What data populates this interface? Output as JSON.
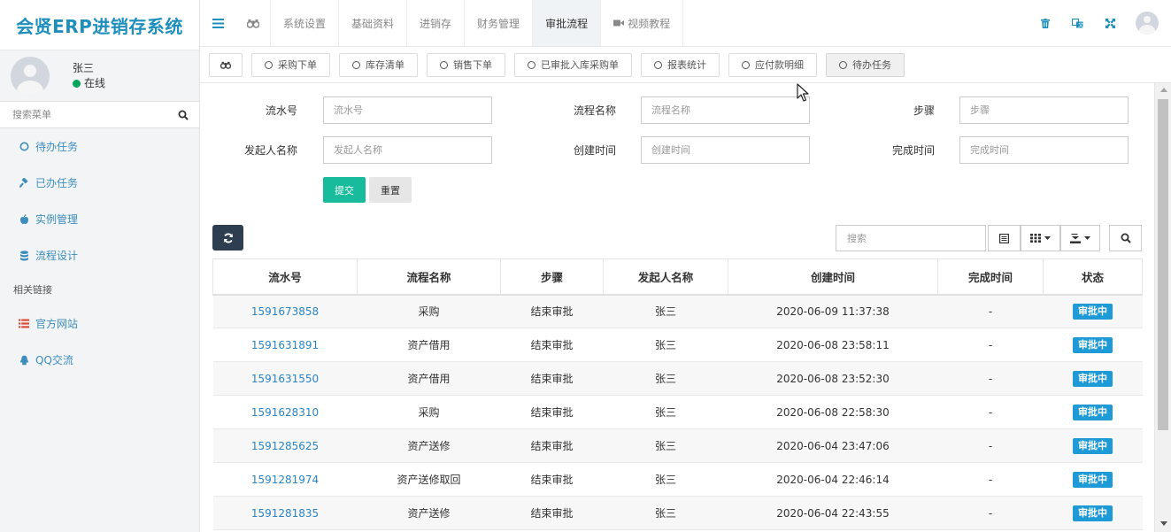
{
  "app": {
    "title": "会贤ERP进销存系统"
  },
  "user": {
    "name": "张三",
    "status": "在线"
  },
  "sidebar": {
    "search_placeholder": "搜索菜单",
    "items": [
      {
        "label": "待办任务",
        "icon": "circle-icon"
      },
      {
        "label": "已办任务",
        "icon": "gavel-icon"
      },
      {
        "label": "实例管理",
        "icon": "apple-icon"
      },
      {
        "label": "流程设计",
        "icon": "database-icon"
      }
    ],
    "section_header": "相关链接",
    "links": [
      {
        "label": "官方网站",
        "icon": "list-icon",
        "color": "#dd4b39"
      },
      {
        "label": "QQ交流",
        "icon": "qq-icon",
        "color": "#3c8dbc"
      }
    ]
  },
  "topnav": {
    "items": [
      "系统设置",
      "基础资料",
      "进销存",
      "财务管理",
      "审批流程",
      "视频教程"
    ],
    "active": "审批流程"
  },
  "tabs": {
    "items": [
      "采购下单",
      "库存清单",
      "销售下单",
      "已审批入库采购单",
      "报表统计",
      "应付款明细",
      "待办任务"
    ],
    "active": "待办任务"
  },
  "form": {
    "fields": [
      {
        "label": "流水号",
        "placeholder": "流水号"
      },
      {
        "label": "流程名称",
        "placeholder": "流程名称"
      },
      {
        "label": "步骤",
        "placeholder": "步骤"
      },
      {
        "label": "发起人名称",
        "placeholder": "发起人名称"
      },
      {
        "label": "创建时间",
        "placeholder": "创建时间"
      },
      {
        "label": "完成时间",
        "placeholder": "完成时间"
      }
    ],
    "submit_label": "提交",
    "reset_label": "重置"
  },
  "table": {
    "search_placeholder": "搜索",
    "columns": [
      "流水号",
      "流程名称",
      "步骤",
      "发起人名称",
      "创建时间",
      "完成时间",
      "状态"
    ],
    "rows": [
      [
        "1591673858",
        "采购",
        "结束审批",
        "张三",
        "2020-06-09 11:37:38",
        "-",
        "审批中"
      ],
      [
        "1591631891",
        "资产借用",
        "结束审批",
        "张三",
        "2020-06-08 23:58:11",
        "-",
        "审批中"
      ],
      [
        "1591631550",
        "资产借用",
        "结束审批",
        "张三",
        "2020-06-08 23:52:30",
        "-",
        "审批中"
      ],
      [
        "1591628310",
        "采购",
        "结束审批",
        "张三",
        "2020-06-08 22:58:30",
        "-",
        "审批中"
      ],
      [
        "1591285625",
        "资产送修",
        "结束审批",
        "张三",
        "2020-06-04 23:47:06",
        "-",
        "审批中"
      ],
      [
        "1591281974",
        "资产送修取回",
        "结束审批",
        "张三",
        "2020-06-04 22:46:14",
        "-",
        "审批中"
      ],
      [
        "1591281835",
        "资产送修",
        "结束审批",
        "张三",
        "2020-06-04 22:43:55",
        "-",
        "审批中"
      ]
    ]
  },
  "colors": {
    "accent": "#1e8fbc",
    "submit": "#18bc9c",
    "badge": "#1e9ad6",
    "link": "#2a84c4",
    "online": "#00a65a"
  }
}
